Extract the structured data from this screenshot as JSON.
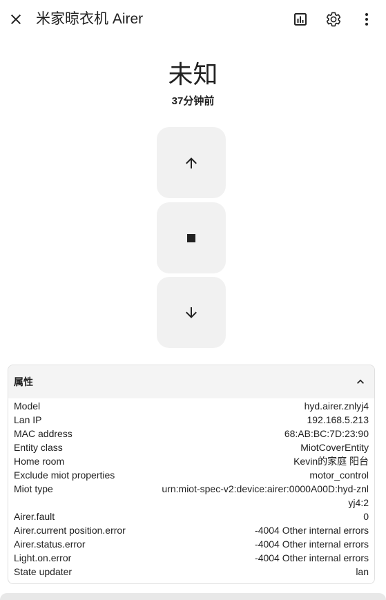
{
  "header": {
    "title": "米家晾衣机 Airer",
    "icons": [
      "close-icon",
      "history-icon",
      "gear-icon",
      "more-vertical-icon"
    ]
  },
  "state": {
    "value": "未知",
    "last_changed": "37分钟前"
  },
  "controls": {
    "icons": [
      "arrow-up-icon",
      "stop-icon",
      "arrow-down-icon"
    ]
  },
  "attributes": {
    "title": "属性",
    "rows": [
      {
        "key": "Model",
        "value": "hyd.airer.znlyj4"
      },
      {
        "key": "Lan IP",
        "value": "192.168.5.213"
      },
      {
        "key": "MAC address",
        "value": "68:AB:BC:7D:23:90"
      },
      {
        "key": "Entity class",
        "value": "MiotCoverEntity"
      },
      {
        "key": "Home room",
        "value": "Kevin的家庭 阳台"
      },
      {
        "key": "Exclude miot properties",
        "value": "motor_control"
      },
      {
        "key": "Miot type",
        "value": "urn:miot-spec-v2:device:airer:0000A00D:hyd-znlyj4:2"
      },
      {
        "key": "Airer.fault",
        "value": "0"
      },
      {
        "key": "Airer.current position.error",
        "value": "-4004 Other internal errors"
      },
      {
        "key": "Airer.status.error",
        "value": "-4004 Other internal errors"
      },
      {
        "key": "Light.on.error",
        "value": "-4004 Other internal errors"
      },
      {
        "key": "State updater",
        "value": "lan"
      }
    ]
  },
  "colors": {
    "button_bg": "#f1f1f1",
    "card_header_bg": "#f4f4f4",
    "text": "#212121"
  }
}
